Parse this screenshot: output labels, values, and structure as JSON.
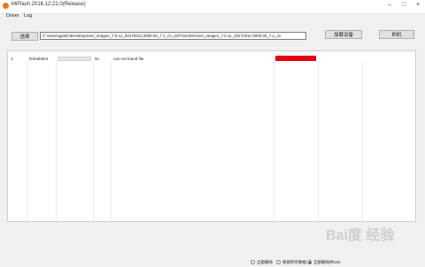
{
  "window": {
    "title": "MiFlash 2016.12.22.0(Release)",
    "minimize_glyph": "–",
    "maximize_glyph": "□",
    "close_glyph": "×",
    "icon": "miflash-app-icon",
    "icon_color": "#e8771e"
  },
  "menu": [
    "Driver",
    "Log"
  ],
  "toolbar": {
    "select_label": "选择",
    "path_value": "C:\\Users\\ganlin\\Desktop\\meri_images_7.5.11_20170311.0000.00_7.1_cn_22f731e39c\\meri_images_7.5.11_20170311.0000.00_7.1_cn",
    "load_device_label": "加载设备",
    "flash_label": "刷机"
  },
  "devices": [
    {
      "index": "1",
      "serial": "fe20eb0e2",
      "progress": 0,
      "elapsed": "0s",
      "status": "can not found file",
      "result_color": "#e60012"
    }
  ],
  "flash_options": {
    "selected": 2,
    "items": [
      "全部删除",
      "保留所有数据",
      "全部删除并lock"
    ]
  },
  "watermark": "Bai度 经验"
}
